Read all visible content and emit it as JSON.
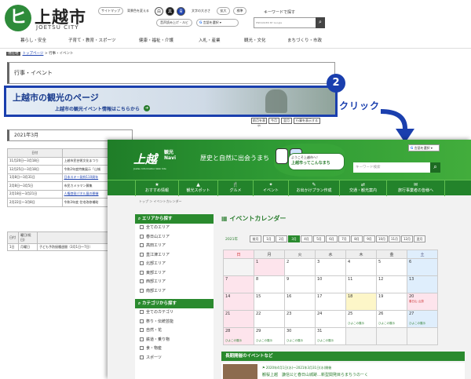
{
  "city": {
    "name": "上越市",
    "name_en": "JOETSU CITY",
    "toolbar": {
      "sitemap": "サイトマップ",
      "color": "背景色を変える",
      "color_white": "白",
      "color_black": "黒",
      "color_blue": "青",
      "font_size": "文字の大きさ",
      "enlarge": "拡大",
      "standard": "標準",
      "audio": "音声読み上げ・ルビ",
      "language": "言語を選択",
      "search_label": "キーワードで探す",
      "search_engine": "ENHANCED BY Google"
    },
    "nav": [
      "暮らし・安全",
      "子育て・教育・スポーツ",
      "健康・福祉・介護",
      "入札・産業",
      "観光・文化",
      "まちづくり・市政"
    ],
    "breadcrumb": {
      "current_label": "現在地",
      "home": "トップページ",
      "page": "行事・イベント"
    },
    "page_title": "行事・イベント",
    "banner": {
      "title": "上越市の観光のページ",
      "sub": "上越市の観光イベント情報はこちらから"
    },
    "sort_buttons": [
      "前月を表示",
      "今月",
      "翌月",
      "行事を表示する"
    ],
    "month_heading": "2021年3月",
    "table_header": "日付",
    "events": [
      {
        "date": "11月20日～3月18日",
        "text": "上越市民芸術文化まつり"
      },
      {
        "date": "12月25日～3月18日",
        "text": "令和2年度特集展示「山城"
      },
      {
        "date": "1月8日～3月31日",
        "text": "日本スキー発祥110周年"
      },
      {
        "date": "2月8日～3月5日",
        "text": "市民カメラマン募集"
      },
      {
        "date": "2月18日～3月21日",
        "text": "人権啓発パネル展の開催"
      },
      {
        "date": "2月22日～3月8日",
        "text": "令和3年度 住宅改修補助"
      }
    ],
    "table2": {
      "day": "日付",
      "weekday": "曜日(祝日)",
      "row_day": "1日",
      "row_weekday": "月曜日",
      "row_text": "子ども予防接種週間（3月1日～7日）"
    }
  },
  "annotation": {
    "step": "2",
    "label": "クリック"
  },
  "tourism": {
    "logo": "上越",
    "logo_sub": "観光 Navi",
    "logo_en": "Joetsu Information Web Site",
    "tagline": "歴史と自然に出会うまち",
    "welcome_line1": "ようこそ上越市へ！",
    "welcome_line2": "上越市ってこんなまち",
    "language": "言語を選択",
    "search_placeholder": "キーワード検索",
    "nav": [
      {
        "icon": "★",
        "label": "おすすめ情報"
      },
      {
        "icon": "▲",
        "label": "観光スポット"
      },
      {
        "icon": "🍴",
        "label": "グルメ"
      },
      {
        "icon": "✦",
        "label": "イベント"
      },
      {
        "icon": "✎",
        "label": "お出かけプラン作成"
      },
      {
        "icon": "⇄",
        "label": "交通・観光案内"
      },
      {
        "icon": "✉",
        "label": "旅行事業者の皆様へ"
      }
    ],
    "breadcrumb": "トップ ＞ イベントカレンダー",
    "area_heading": "エリアから探す",
    "areas": [
      "全てのエリア",
      "春日山エリア",
      "高田エリア",
      "直江津エリア",
      "北部エリア",
      "東部エリア",
      "西部エリア",
      "南部エリア"
    ],
    "category_heading": "カテゴリから探す",
    "categories": [
      "全てのカテゴリ",
      "祭り・伝統芸能",
      "自然・花",
      "鉄道・乗り物",
      "食・物産",
      "スポーツ"
    ],
    "calendar_title": "イベントカレンダー",
    "year": "2021年",
    "months": [
      "前月",
      "1月",
      "2月",
      "3月",
      "4月",
      "5月",
      "6月",
      "7月",
      "8月",
      "9月",
      "10月",
      "11月",
      "12月",
      "翌月"
    ],
    "weekdays": [
      "日",
      "月",
      "火",
      "水",
      "木",
      "金",
      "土"
    ],
    "weeks": [
      [
        "",
        "1",
        "2",
        "3",
        "4",
        "5",
        "6"
      ],
      [
        "7",
        "8",
        "9",
        "10",
        "11",
        "12",
        "13"
      ],
      [
        "14",
        "15",
        "16",
        "17",
        "18",
        "19",
        "20"
      ],
      [
        "21",
        "22",
        "23",
        "24",
        "25",
        "26",
        "27"
      ],
      [
        "28",
        "29",
        "30",
        "31",
        "",
        "",
        ""
      ]
    ],
    "event_tag": "ひよこの展示",
    "event_tag2": "春日山 山頂",
    "long_heading": "長期開催のイベントなど",
    "long_text": "2020年4月1日(水)～2021年3月31日(水)開催",
    "long_title": "観桜上越　謙信公と春日山城跡…新型関発目らまちうのーく"
  }
}
